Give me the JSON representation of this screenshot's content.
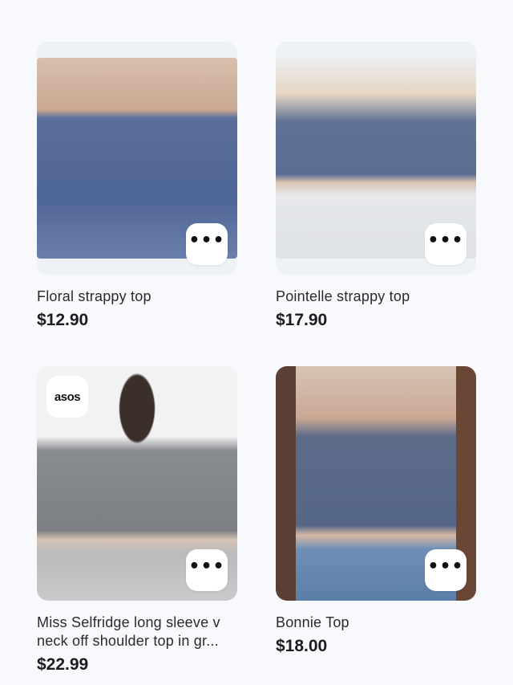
{
  "products": [
    {
      "title": "Floral strappy top",
      "price": "$12.90",
      "more_label": "•••"
    },
    {
      "title": "Pointelle strappy top",
      "price": "$17.90",
      "more_label": "•••"
    },
    {
      "title": "Miss Selfridge long sleeve v neck off shoulder top in gr...",
      "price": "$22.99",
      "more_label": "•••",
      "badge": "asos"
    },
    {
      "title": "Bonnie Top",
      "price": "$18.00",
      "more_label": "•••"
    }
  ]
}
